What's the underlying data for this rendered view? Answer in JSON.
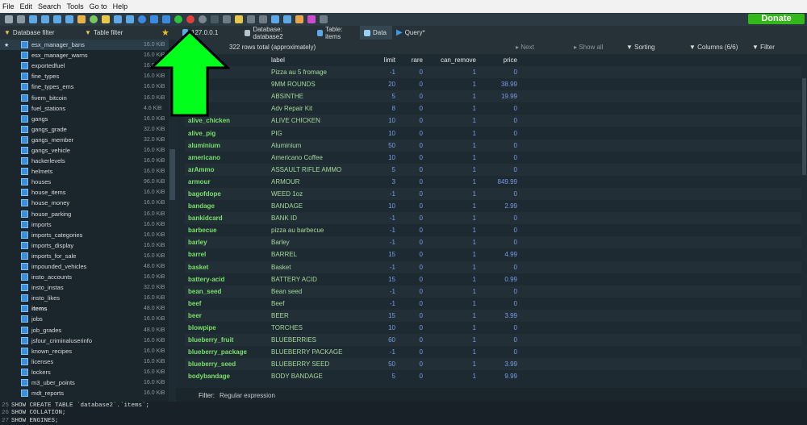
{
  "menu": [
    "File",
    "Edit",
    "Search",
    "Tools",
    "Go to",
    "Help"
  ],
  "donate_label": "Donate",
  "tabs": {
    "db_filter": "Database filter",
    "table_filter": "Table filter",
    "host": "127.0.0.1",
    "database": "Database: database2",
    "table": "Table: items",
    "data": "Data",
    "query": "Query*"
  },
  "grid_info": {
    "rows_total": "322 rows total (approximately)",
    "next": "Next",
    "show_all": "Show all",
    "sorting": "Sorting",
    "columns": "Columns (6/6)",
    "filter": "Filter"
  },
  "tables": [
    {
      "name": "esx_manager_bans",
      "size": "16.0 KiB"
    },
    {
      "name": "esx_manager_warns",
      "size": "16.0 KiB"
    },
    {
      "name": "exportedfuel",
      "size": "16.0 KiB"
    },
    {
      "name": "fine_types",
      "size": "16.0 KiB"
    },
    {
      "name": "fine_types_ems",
      "size": "16.0 KiB"
    },
    {
      "name": "fivem_bitcoin",
      "size": "16.0 KiB"
    },
    {
      "name": "fuel_stations",
      "size": "4.6 KiB"
    },
    {
      "name": "gangs",
      "size": "16.0 KiB"
    },
    {
      "name": "gangs_grade",
      "size": "32.0 KiB"
    },
    {
      "name": "gangs_member",
      "size": "32.0 KiB"
    },
    {
      "name": "gangs_vehicle",
      "size": "16.0 KiB"
    },
    {
      "name": "hackerlevels",
      "size": "16.0 KiB"
    },
    {
      "name": "helmets",
      "size": "16.0 KiB"
    },
    {
      "name": "houses",
      "size": "96.0 KiB"
    },
    {
      "name": "house_items",
      "size": "16.0 KiB"
    },
    {
      "name": "house_money",
      "size": "16.0 KiB"
    },
    {
      "name": "house_parking",
      "size": "16.0 KiB"
    },
    {
      "name": "imports",
      "size": "16.0 KiB"
    },
    {
      "name": "imports_categories",
      "size": "16.0 KiB"
    },
    {
      "name": "imports_display",
      "size": "16.0 KiB"
    },
    {
      "name": "imports_for_sale",
      "size": "16.0 KiB"
    },
    {
      "name": "impounded_vehicles",
      "size": "48.0 KiB"
    },
    {
      "name": "insto_accounts",
      "size": "16.0 KiB"
    },
    {
      "name": "insto_instas",
      "size": "32.0 KiB"
    },
    {
      "name": "insto_likes",
      "size": "16.0 KiB"
    },
    {
      "name": "items",
      "size": "48.0 KiB"
    },
    {
      "name": "jobs",
      "size": "16.0 KiB"
    },
    {
      "name": "job_grades",
      "size": "48.0 KiB"
    },
    {
      "name": "jsfour_criminaluserinfo",
      "size": "16.0 KiB"
    },
    {
      "name": "known_recipes",
      "size": "16.0 KiB"
    },
    {
      "name": "licenses",
      "size": "16.0 KiB"
    },
    {
      "name": "lockers",
      "size": "16.0 KiB"
    },
    {
      "name": "m3_uber_points",
      "size": "16.0 KiB"
    },
    {
      "name": "mdt_reports",
      "size": "16.0 KiB"
    }
  ],
  "columns": [
    "label",
    "limit",
    "rare",
    "can_remove",
    "price"
  ],
  "rows": [
    {
      "name": "",
      "label": "Pizza au 5 fromage",
      "limit": "-1",
      "rare": "0",
      "can_remove": "1",
      "price": "0"
    },
    {
      "name": "",
      "label": "9MM ROUNDS",
      "limit": "20",
      "rare": "0",
      "can_remove": "1",
      "price": "38.99"
    },
    {
      "name": "",
      "label": "ABSINTHE",
      "limit": "5",
      "rare": "0",
      "can_remove": "1",
      "price": "19.99"
    },
    {
      "name": "",
      "label": "Adv Repair Kit",
      "limit": "8",
      "rare": "0",
      "can_remove": "1",
      "price": "0"
    },
    {
      "name": "alive_chicken",
      "label": "ALIVE CHICKEN",
      "limit": "10",
      "rare": "0",
      "can_remove": "1",
      "price": "0"
    },
    {
      "name": "alive_pig",
      "label": "PIG",
      "limit": "10",
      "rare": "0",
      "can_remove": "1",
      "price": "0"
    },
    {
      "name": "aluminium",
      "label": "Aluminium",
      "limit": "50",
      "rare": "0",
      "can_remove": "1",
      "price": "0"
    },
    {
      "name": "americano",
      "label": "Americano Coffee",
      "limit": "10",
      "rare": "0",
      "can_remove": "1",
      "price": "0"
    },
    {
      "name": "arAmmo",
      "label": "ASSAULT RIFLE AMMO",
      "limit": "5",
      "rare": "0",
      "can_remove": "1",
      "price": "0"
    },
    {
      "name": "armour",
      "label": "ARMOUR",
      "limit": "3",
      "rare": "0",
      "can_remove": "1",
      "price": "849.99"
    },
    {
      "name": "bagofdope",
      "label": "WEED 1oz",
      "limit": "-1",
      "rare": "0",
      "can_remove": "1",
      "price": "0"
    },
    {
      "name": "bandage",
      "label": "BANDAGE",
      "limit": "10",
      "rare": "0",
      "can_remove": "1",
      "price": "2.99"
    },
    {
      "name": "bankidcard",
      "label": "BANK ID",
      "limit": "-1",
      "rare": "0",
      "can_remove": "1",
      "price": "0"
    },
    {
      "name": "barbecue",
      "label": "pizza au barbecue",
      "limit": "-1",
      "rare": "0",
      "can_remove": "1",
      "price": "0"
    },
    {
      "name": "barley",
      "label": "Barley",
      "limit": "-1",
      "rare": "0",
      "can_remove": "1",
      "price": "0"
    },
    {
      "name": "barrel",
      "label": "BARREL",
      "limit": "15",
      "rare": "0",
      "can_remove": "1",
      "price": "4.99"
    },
    {
      "name": "basket",
      "label": "Basket",
      "limit": "-1",
      "rare": "0",
      "can_remove": "1",
      "price": "0"
    },
    {
      "name": "battery-acid",
      "label": "BATTERY ACID",
      "limit": "15",
      "rare": "0",
      "can_remove": "1",
      "price": "0.99"
    },
    {
      "name": "bean_seed",
      "label": "Bean seed",
      "limit": "-1",
      "rare": "0",
      "can_remove": "1",
      "price": "0"
    },
    {
      "name": "beef",
      "label": "Beef",
      "limit": "-1",
      "rare": "0",
      "can_remove": "1",
      "price": "0"
    },
    {
      "name": "beer",
      "label": "BEER",
      "limit": "15",
      "rare": "0",
      "can_remove": "1",
      "price": "3.99"
    },
    {
      "name": "blowpipe",
      "label": "TORCHES",
      "limit": "10",
      "rare": "0",
      "can_remove": "1",
      "price": "0"
    },
    {
      "name": "blueberry_fruit",
      "label": "BLUEBERRIES",
      "limit": "60",
      "rare": "0",
      "can_remove": "1",
      "price": "0"
    },
    {
      "name": "blueberry_package",
      "label": "BLUEBERRY PACKAGE",
      "limit": "-1",
      "rare": "0",
      "can_remove": "1",
      "price": "0"
    },
    {
      "name": "blueberry_seed",
      "label": "BLUEBERRY SEED",
      "limit": "50",
      "rare": "0",
      "can_remove": "1",
      "price": "3.99"
    },
    {
      "name": "bodybandage",
      "label": "BODY BANDAGE",
      "limit": "5",
      "rare": "0",
      "can_remove": "1",
      "price": "9.99"
    }
  ],
  "filter": {
    "label": "Filter:",
    "value": "Regular expression"
  },
  "log": [
    {
      "n": "25",
      "text": "SHOW CREATE TABLE `database2`.`items`;"
    },
    {
      "n": "26",
      "text": "SHOW COLLATION;"
    },
    {
      "n": "27",
      "text": "SHOW ENGINES;"
    }
  ],
  "colors": {
    "accent_green": "#00ff1a",
    "row_name": "#7ae06b",
    "number": "#7b9be8"
  },
  "overlay": {
    "arrow": "big-green-up-arrow"
  }
}
